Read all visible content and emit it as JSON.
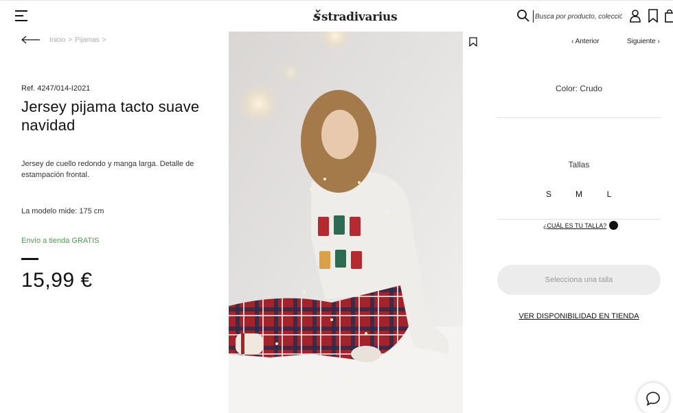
{
  "header": {
    "logo_text": "stradivarius",
    "logo_mark": "š",
    "search_placeholder": "Busca por producto, colección..."
  },
  "breadcrumb": {
    "items": [
      "Inicio",
      "Pijamas"
    ],
    "separator": ">"
  },
  "product": {
    "ref": "Ref. 4247/014-I2021",
    "title": "Jersey pijama tacto suave navidad",
    "description": "Jersey de cuello redondo y manga larga. Detalle de estampación frontal.",
    "model_info": "La modelo mide: 175 cm",
    "shipping": "Envío a tienda GRATIS",
    "price": "15,99 €"
  },
  "nav": {
    "prev_label": "Anterior",
    "next_label": "Siguiente"
  },
  "options": {
    "color_label": "Color: Crudo",
    "sizes_label": "Tallas",
    "sizes": [
      "S",
      "M",
      "L"
    ],
    "fit_link": "¿CUÁL ES TU TALLA?",
    "select_button": "Selecciona una talla",
    "store_link": "VER DISPONIBILIDAD EN TIENDA"
  },
  "colors": {
    "shipping_green": "#4a9a4a",
    "button_bg": "#ececec",
    "button_text": "#999999"
  },
  "icons": [
    "menu-icon",
    "search-icon",
    "user-icon",
    "bookmark-icon",
    "bag-icon",
    "back-arrow-icon",
    "chevron-left-icon",
    "chevron-right-icon",
    "size-guide-icon",
    "chat-icon"
  ]
}
